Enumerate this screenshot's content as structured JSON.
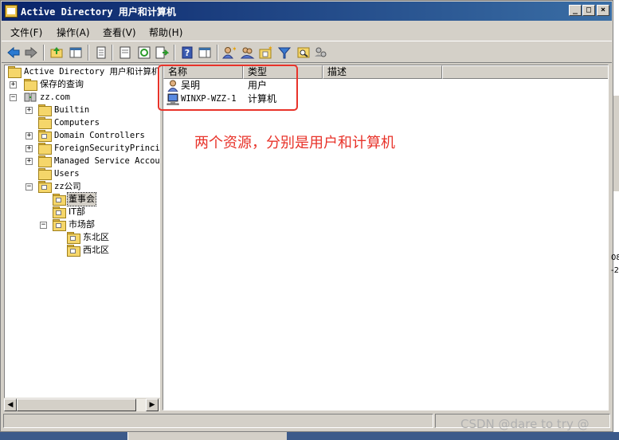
{
  "window": {
    "title": "Active Directory 用户和计算机",
    "min_label": "_",
    "max_label": "□",
    "close_label": "×"
  },
  "menu": [
    {
      "label": "文件(F)"
    },
    {
      "label": "操作(A)"
    },
    {
      "label": "查看(V)"
    },
    {
      "label": "帮助(H)"
    }
  ],
  "tree": {
    "root": "Active Directory 用户和计算机",
    "saved_queries": "保存的查询",
    "domain": "zz.com",
    "builtin": "Builtin",
    "computers": "Computers",
    "domain_controllers": "Domain Controllers",
    "foreign": "ForeignSecurityPrincip",
    "managed": "Managed Service Accour",
    "users": "Users",
    "zz_company": "zz公司",
    "board": "董事会",
    "it": "IT部",
    "market": "市场部",
    "northeast": "东北区",
    "northwest": "西北区"
  },
  "list": {
    "columns": [
      "名称",
      "类型",
      "描述"
    ],
    "rows": [
      {
        "name": "吴明",
        "type": "用户",
        "icon": "user-icon"
      },
      {
        "name": "WINXP-WZZ-1",
        "type": "计算机",
        "icon": "computer-icon"
      }
    ]
  },
  "annotation": "两个资源，分别是用户和计算机",
  "edge_text": [
    "08",
    "-2"
  ],
  "watermark": "CSDN @dare to try @"
}
